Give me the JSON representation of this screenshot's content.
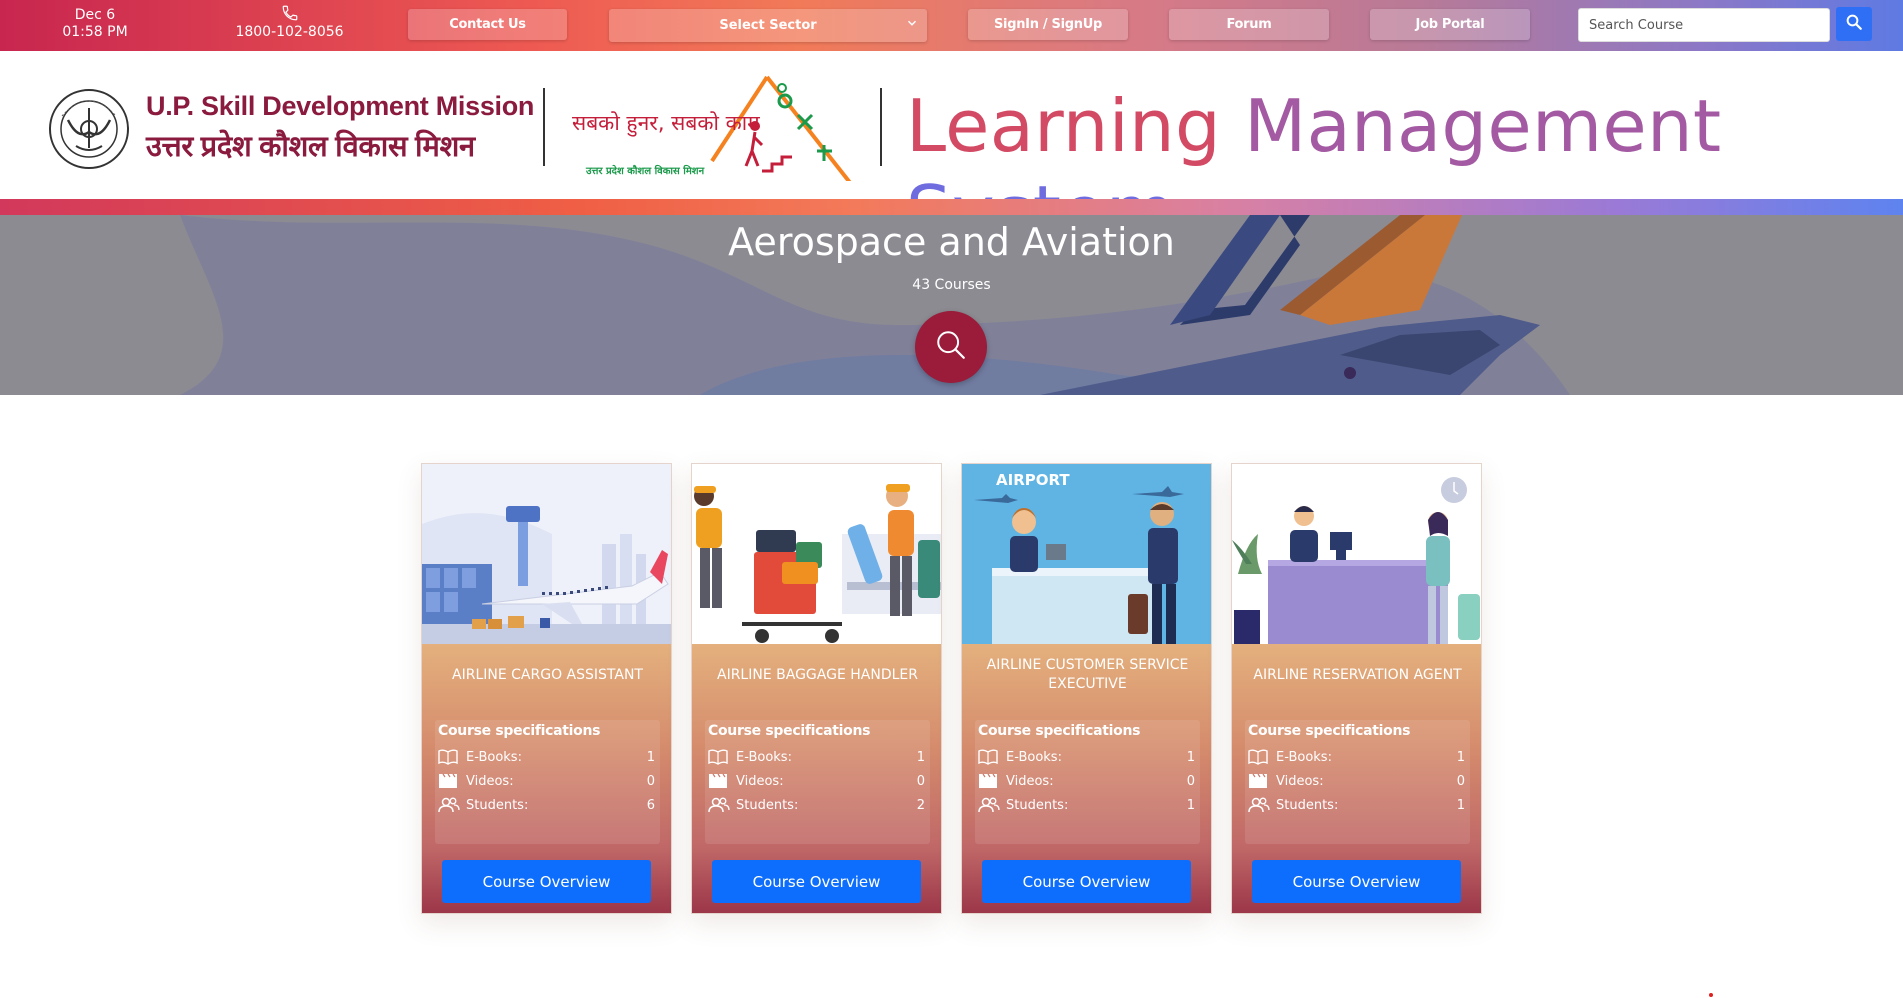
{
  "topbar": {
    "date": "Dec 6",
    "time": "01:58 PM",
    "phone": "1800-102-8056",
    "contact_label": "Contact Us",
    "sector_selected": "Select Sector",
    "signin_label": "SignIn / SignUp",
    "forum_label": "Forum",
    "job_portal_label": "Job Portal",
    "search_placeholder": "Search Course",
    "icons": {
      "phone": "phone-icon",
      "chevron": "chevron-down-icon",
      "search": "search-icon"
    }
  },
  "header": {
    "org_name_en": "U.P. Skill Development Mission",
    "org_name_hi": "उत्तर प्रदेश कौशल विकास मिशन",
    "skill_slogan": "सबको हुनर, सबको काम",
    "skill_sub": "उत्तर प्रदेश कौशल विकास मिशन",
    "lms_word1": "Learning",
    "lms_word2": "Management",
    "lms_word3": "System"
  },
  "banner": {
    "title": "Aerospace and Aviation",
    "count": "43 Courses"
  },
  "specs": {
    "heading": "Course specifications",
    "ebooks_label": "E-Books:",
    "videos_label": "Videos:",
    "students_label": "Students:",
    "button_label": "Course Overview"
  },
  "courses": [
    {
      "title": "AIRLINE CARGO ASSISTANT",
      "ebooks": "1",
      "videos": "0",
      "students": "6"
    },
    {
      "title": "AIRLINE BAGGAGE HANDLER",
      "ebooks": "1",
      "videos": "0",
      "students": "2"
    },
    {
      "title": "AIRLINE CUSTOMER SERVICE EXECUTIVE",
      "ebooks": "1",
      "videos": "0",
      "students": "1",
      "image_text": "AIRPORT"
    },
    {
      "title": "AIRLINE RESERVATION AGENT",
      "ebooks": "1",
      "videos": "0",
      "students": "1"
    }
  ],
  "colors": {
    "accent_blue": "#0d6efd",
    "brand_maroon": "#8a1a3e",
    "banner_button": "#9a1b3a"
  }
}
